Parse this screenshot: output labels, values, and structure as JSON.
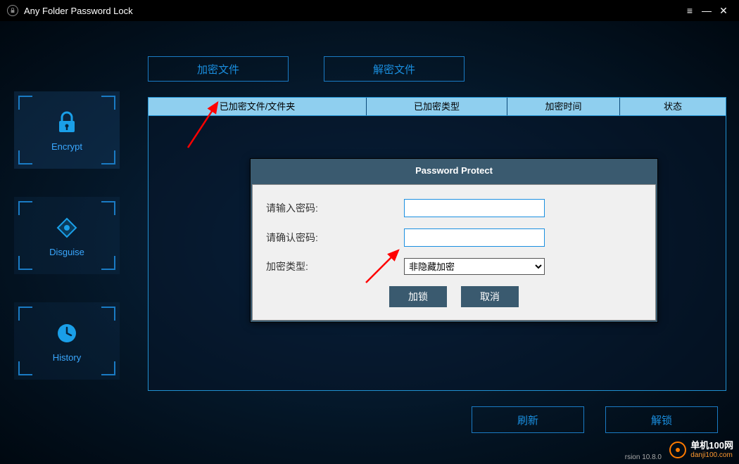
{
  "app": {
    "title": "Any Folder Password Lock"
  },
  "window": {
    "menu": "≡",
    "min": "—",
    "close": "✕"
  },
  "sidebar": {
    "encrypt": "Encrypt",
    "disguise": "Disguise",
    "history": "History"
  },
  "actions": {
    "encrypt_file": "加密文件",
    "decrypt_file": "解密文件",
    "refresh": "刷新",
    "unlock": "解锁"
  },
  "table": {
    "col_file": "已加密文件/文件夹",
    "col_type": "已加密类型",
    "col_time": "加密时间",
    "col_status": "状态"
  },
  "dialog": {
    "title": "Password Protect",
    "label_password": "请输入密码:",
    "label_confirm": "请确认密码:",
    "label_type": "加密类型:",
    "type_option": "非隐藏加密",
    "btn_lock": "加锁",
    "btn_cancel": "取消"
  },
  "watermark": {
    "line1": "单机100网",
    "line2": "danji100.com"
  },
  "version": "rsion 10.8.0"
}
